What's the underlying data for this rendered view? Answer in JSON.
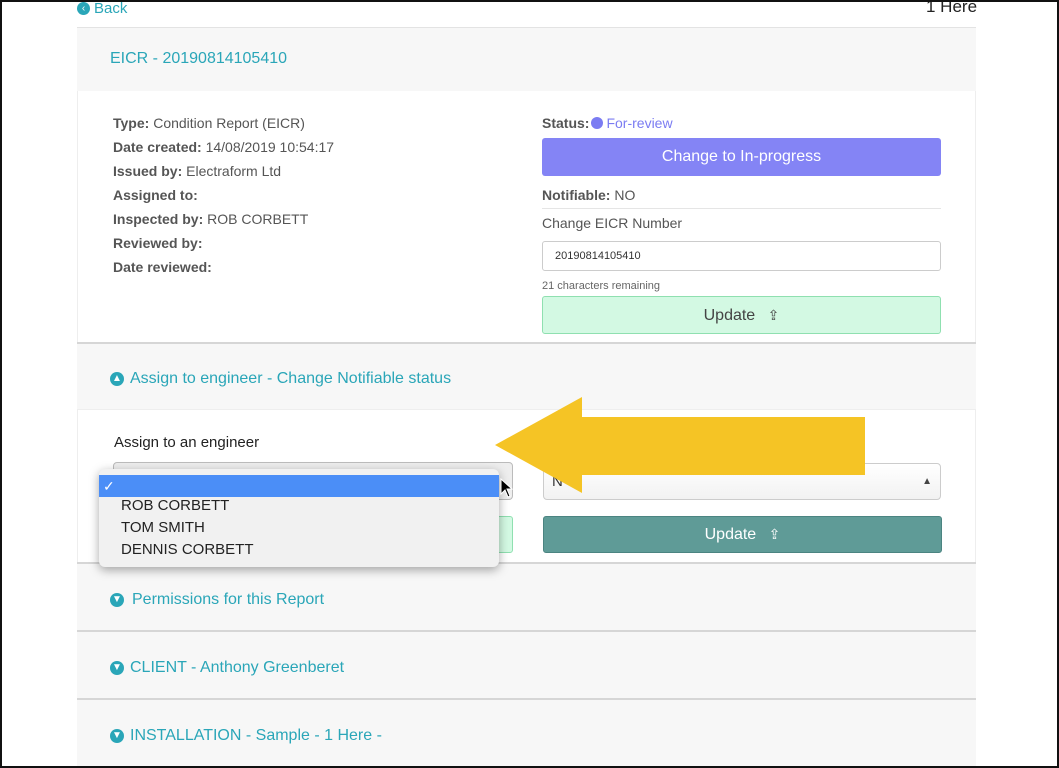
{
  "nav": {
    "back_label": "Back",
    "top_right_text": "1 Here"
  },
  "report": {
    "title": "EICR - 20190814105410",
    "details": [
      {
        "label": "Type:",
        "value": "Condition Report (EICR)"
      },
      {
        "label": "Date created:",
        "value": "14/08/2019 10:54:17"
      },
      {
        "label": "Issued by:",
        "value": "Electraform Ltd"
      },
      {
        "label": "Assigned to:",
        "value": ""
      },
      {
        "label": "Inspected by:",
        "value": "ROB CORBETT"
      },
      {
        "label": "Reviewed by:",
        "value": ""
      },
      {
        "label": "Date reviewed:",
        "value": ""
      }
    ],
    "status_label": "Status:",
    "status_value": "For-review",
    "status_color": "#7b7cf2",
    "change_status_button": "Change to In-progress",
    "notifiable_label": "Notifiable:",
    "notifiable_value": "NO",
    "change_number_label": "Change EICR Number",
    "eicr_number_value": "20190814105410",
    "remaining_text": "21 characters remaining",
    "update_button": "Update"
  },
  "assign_section": {
    "title": "Assign to engineer - Change Notifiable status",
    "assign_label": "Assign to an engineer",
    "notifiable_select_value": "N",
    "update_button": "Update",
    "dropdown": {
      "selected_mark": "✓",
      "options": [
        "ROB CORBETT",
        "TOM SMITH",
        "DENNIS CORBETT"
      ]
    }
  },
  "sections": {
    "permissions": "Permissions for this Report",
    "client": "CLIENT - Anthony Greenberet",
    "installation": "INSTALLATION - Sample - 1 Here -"
  },
  "colors": {
    "accent": "#2aa6b8",
    "purple": "#8484f5",
    "green_bg": "#d3f9e3",
    "teal_button": "#5f9b97",
    "highlight_arrow": "#f5c425"
  }
}
